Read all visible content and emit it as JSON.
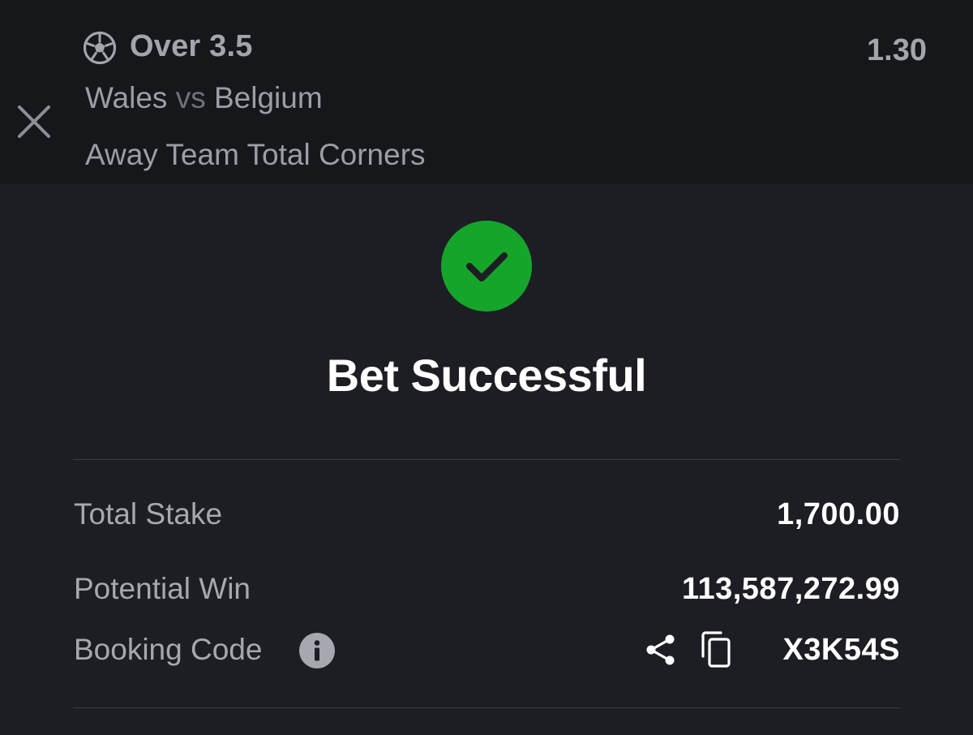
{
  "selection": {
    "market": "Over 3.5",
    "odds": "1.30",
    "home_team": "Wales",
    "vs": "vs",
    "away_team": "Belgium",
    "market_type": "Away Team Total Corners"
  },
  "result": {
    "title": "Bet Successful",
    "status_color": "#16a52b"
  },
  "summary": {
    "total_stake_label": "Total Stake",
    "total_stake_value": "1,700.00",
    "potential_win_label": "Potential Win",
    "potential_win_value": "113,587,272.99",
    "booking_code_label": "Booking Code",
    "booking_code_value": "X3K54S"
  },
  "icons": {
    "close": "close-icon",
    "ball": "soccer-ball-icon",
    "success": "check-circle-icon",
    "info": "info-icon",
    "share": "share-icon",
    "copy": "copy-icon"
  }
}
